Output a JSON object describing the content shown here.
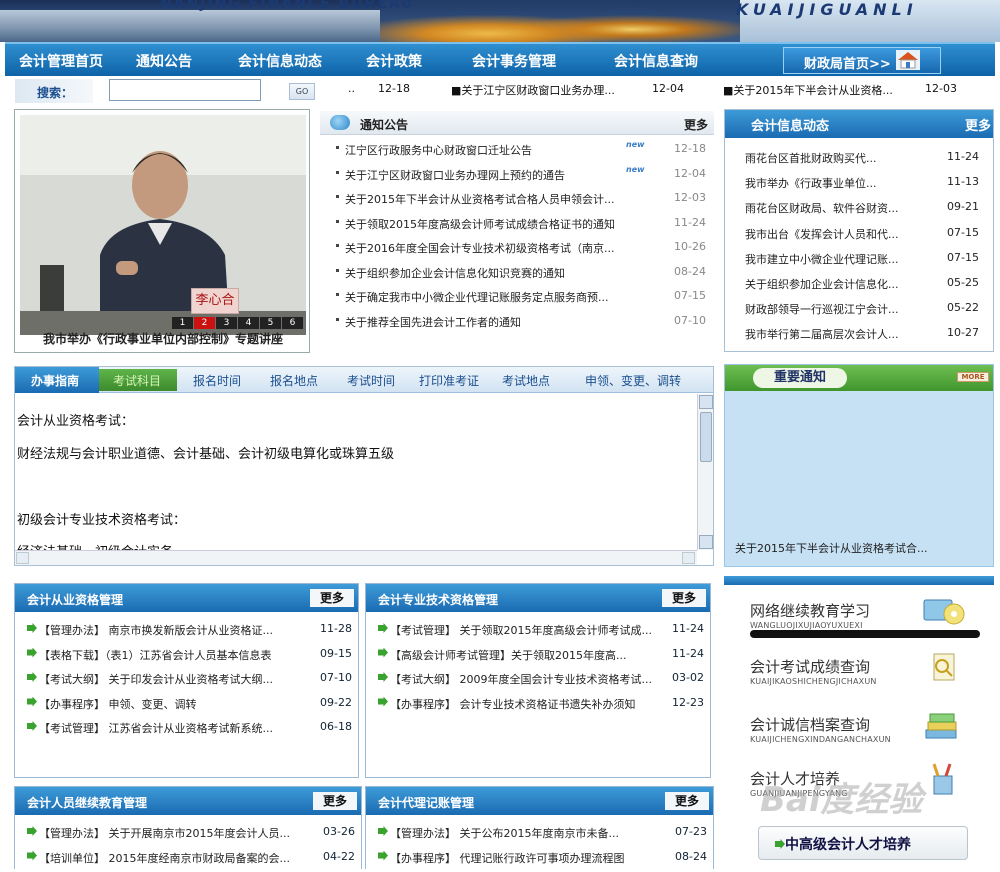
{
  "banner": {
    "en_title": "NANJING FINANCE BUREAU",
    "right_title": "KUAIJIGUANLI"
  },
  "nav": {
    "items": [
      "会计管理首页",
      "通知公告",
      "会计信息动态",
      "会计政策",
      "会计事务管理",
      "会计信息查询"
    ],
    "home_label": "财政局首页>>"
  },
  "search": {
    "label": "搜索：",
    "value": "",
    "go": "GO"
  },
  "ticker": [
    {
      "text": "..",
      "date": "12-18"
    },
    {
      "text": "■关于江宁区财政窗口业务办理...",
      "date": "12-04"
    },
    {
      "text": "■关于2015年下半会计从业资格...",
      "date": "12-03"
    }
  ],
  "photo": {
    "caption": "我市举办《行政事业单位内部控制》专题讲座",
    "nametag": "李心合",
    "slides": [
      "1",
      "2",
      "3",
      "4",
      "5",
      "6"
    ],
    "active_slide": 1
  },
  "notice": {
    "title": "通知公告",
    "more": "更多",
    "new_badge": "new",
    "items": [
      {
        "text": "江宁区行政服务中心财政窗口迁址公告",
        "date": "12-18",
        "new": true
      },
      {
        "text": "关于江宁区财政窗口业务办理网上预约的通告",
        "date": "12-04",
        "new": true
      },
      {
        "text": "关于2015年下半会计从业资格考试合格人员申领会计...",
        "date": "12-03",
        "new": false
      },
      {
        "text": "关于领取2015年度高级会计师考试成绩合格证书的通知",
        "date": "11-24",
        "new": false
      },
      {
        "text": "关于2016年度全国会计专业技术初级资格考试（南京...",
        "date": "10-26",
        "new": false
      },
      {
        "text": "关于组织参加企业会计信息化知识竞赛的通知",
        "date": "08-24",
        "new": false
      },
      {
        "text": "关于确定我市中小微企业代理记账服务定点服务商预...",
        "date": "07-15",
        "new": false
      },
      {
        "text": "关于推荐全国先进会计工作者的通知",
        "date": "07-10",
        "new": false
      }
    ]
  },
  "dynamics": {
    "title": "会计信息动态",
    "more": "更多",
    "items": [
      {
        "text": "雨花台区首批财政购买代...",
        "date": "11-24"
      },
      {
        "text": "我市举办《行政事业单位...",
        "date": "11-13"
      },
      {
        "text": "雨花台区财政局、软件谷财资...",
        "date": "09-21"
      },
      {
        "text": "我市出台《发挥会计人员和代...",
        "date": "07-15"
      },
      {
        "text": "我市建立中小微企业代理记账...",
        "date": "07-15"
      },
      {
        "text": "关于组织参加企业会计信息化...",
        "date": "05-25"
      },
      {
        "text": "财政部领导一行巡视江宁会计...",
        "date": "05-22"
      },
      {
        "text": "我市举行第二届高层次会计人...",
        "date": "10-27"
      }
    ]
  },
  "guide": {
    "lead": "办事指南",
    "active": "考试科目",
    "tabs": [
      "报名时间",
      "报名地点",
      "考试时间",
      "打印准考证",
      "考试地点",
      "申领、变更、调转"
    ],
    "lines": [
      "会计从业资格考试：",
      "财经法规与会计职业道德、会计基础、会计初级电算化或珠算五级",
      "",
      "初级会计专业技术资格考试：",
      "经济法基础、初级会计实务"
    ]
  },
  "important": {
    "title": "重要通知",
    "more": "MORE",
    "text": "关于2015年下半会计从业资格考试合..."
  },
  "boxes": [
    {
      "title": "会计从业资格管理",
      "more": "更多",
      "items": [
        {
          "text": "【管理办法】 南京市换发新版会计从业资格证...",
          "date": "11-28"
        },
        {
          "text": "【表格下载】（表1）江苏省会计人员基本信息表",
          "date": "09-15"
        },
        {
          "text": "【考试大纲】 关于印发会计从业资格考试大纲...",
          "date": "07-10"
        },
        {
          "text": "【办事程序】 申领、变更、调转",
          "date": "09-22"
        },
        {
          "text": "【考试管理】 江苏省会计从业资格考试新系统...",
          "date": "06-18"
        }
      ]
    },
    {
      "title": "会计专业技术资格管理",
      "more": "更多",
      "items": [
        {
          "text": "【考试管理】 关于领取2015年度高级会计师考试成...",
          "date": "11-24"
        },
        {
          "text": "【高级会计师考试管理】关于领取2015年度高...",
          "date": "11-24"
        },
        {
          "text": "【考试大纲】 2009年度全国会计专业技术资格考试...",
          "date": "03-02"
        },
        {
          "text": "【办事程序】 会计专业技术资格证书遗失补办须知",
          "date": "12-23"
        }
      ]
    },
    {
      "title": "会计人员继续教育管理",
      "more": "更多",
      "items": [
        {
          "text": "【管理办法】 关于开展南京市2015年度会计人员...",
          "date": "03-26"
        },
        {
          "text": "【培训单位】 2015年度经南京市财政局备案的会...",
          "date": "04-22"
        }
      ]
    },
    {
      "title": "会计代理记账管理",
      "more": "更多",
      "items": [
        {
          "text": "【管理办法】 关于公布2015年度南京市未备...",
          "date": "07-23"
        },
        {
          "text": "【办事程序】 代理记账行政许可事项办理流程图",
          "date": "08-24"
        }
      ]
    }
  ],
  "quicklinks": [
    {
      "cn": "网络继续教育学习",
      "en": "WANGLUOJIXUJIAOYUXUEXI",
      "icon": "monitor-cd-icon"
    },
    {
      "cn": "会计考试成绩查询",
      "en": "KUAIJIKAOSHICHENGJICHAXUN",
      "icon": "magnifier-doc-icon"
    },
    {
      "cn": "会计诚信档案查询",
      "en": "KUAIJICHENGXINDANGANCHAXUN",
      "icon": "books-icon"
    },
    {
      "cn": "会计人才培养",
      "en": "GUANJIUANJIPENGYANG",
      "icon": "pencil-cup-icon"
    }
  ],
  "cultivate": "中高级会计人才培养",
  "watermark": "Bai度经验"
}
